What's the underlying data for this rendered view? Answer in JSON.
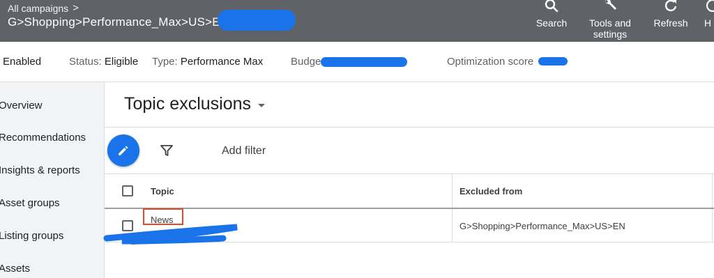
{
  "topbar": {
    "crumb_parent": "All campaigns",
    "crumb_chevron": ">",
    "campaign_name": "G>Shopping>Performance_Max>US>EN",
    "buttons": [
      {
        "label_line1": "Search",
        "label_line2": "",
        "icon": "search-icon"
      },
      {
        "label_line1": "Tools and",
        "label_line2": "settings",
        "icon": "tools-icon"
      },
      {
        "label_line1": "Refresh",
        "label_line2": "",
        "icon": "refresh-icon"
      },
      {
        "label_line1": "H",
        "label_line2": "",
        "icon": "help-icon"
      }
    ]
  },
  "status": {
    "enabled": "Enabled",
    "status_label": "Status:",
    "status_value": "Eligible",
    "type_label": "Type:",
    "type_value": "Performance Max",
    "budget_label": "Budge",
    "optimization_label": "Optimization score"
  },
  "sidebar": {
    "items": [
      {
        "label": "Overview"
      },
      {
        "label": "Recommendations"
      },
      {
        "label": "Insights & reports"
      },
      {
        "label": "Asset groups"
      },
      {
        "label": "Listing groups"
      },
      {
        "label": "Assets"
      }
    ]
  },
  "main": {
    "title": "Topic exclusions",
    "add_filter": "Add filter",
    "table": {
      "columns": [
        "Topic",
        "Excluded from"
      ],
      "rows": [
        {
          "topic": "News",
          "excluded_from": "G>Shopping>Performance_Max>US>EN"
        }
      ]
    }
  },
  "colors": {
    "topbar_bg": "#5f6368",
    "accent_blue": "#1a73e8",
    "highlight_red": "#e8472c",
    "sidebar_bg": "#f1f3f4"
  }
}
